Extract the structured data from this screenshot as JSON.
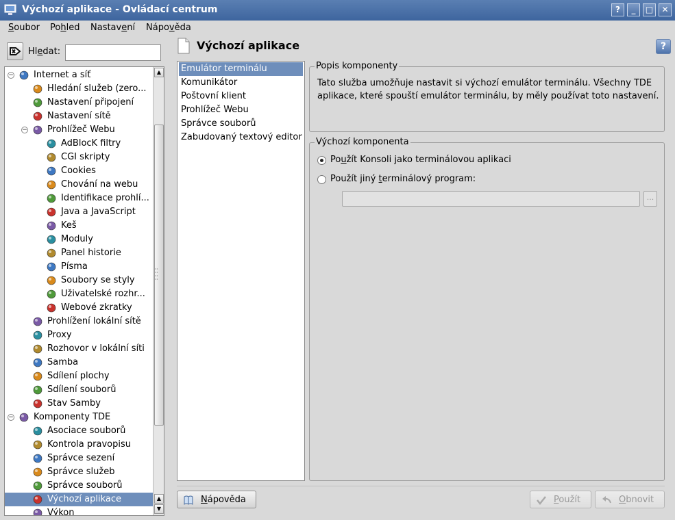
{
  "window": {
    "title": "Výchozí aplikace - Ovládací centrum",
    "buttons": {
      "help": "?",
      "minimize": "_",
      "maximize": "□",
      "close": "✕"
    }
  },
  "menubar": {
    "items": [
      {
        "pre": "",
        "u": "S",
        "post": "oubor"
      },
      {
        "pre": "Po",
        "u": "h",
        "post": "led"
      },
      {
        "pre": "Nastav",
        "u": "e",
        "post": "ní"
      },
      {
        "pre": "Nápo",
        "u": "v",
        "post": "ěda"
      }
    ]
  },
  "search": {
    "label_pre": "Hl",
    "label_u": "e",
    "label_post": "dat:",
    "value": "",
    "placeholder": ""
  },
  "tree": {
    "items": [
      {
        "label": "Internet a síť",
        "icon": "globe-icon",
        "level": 0,
        "expander": "⊖"
      },
      {
        "label": "Hledání služeb (zero...",
        "icon": "service-discovery-icon",
        "level": 1
      },
      {
        "label": "Nastavení připojení",
        "icon": "connection-icon",
        "level": 1
      },
      {
        "label": "Nastavení sítě",
        "icon": "network-icon",
        "level": 1
      },
      {
        "label": "Prohlížeč Webu",
        "icon": "web-browser-icon",
        "level": 1,
        "expander": "⊖"
      },
      {
        "label": "AdBlocK filtry",
        "icon": "filter-icon",
        "level": 2
      },
      {
        "label": "CGI skripty",
        "icon": "gear-icon",
        "level": 2
      },
      {
        "label": "Cookies",
        "icon": "cookie-icon",
        "level": 2
      },
      {
        "label": "Chování na webu",
        "icon": "globe-icon",
        "level": 2
      },
      {
        "label": "Identifikace prohlí...",
        "icon": "identification-icon",
        "level": 2
      },
      {
        "label": "Java a JavaScript",
        "icon": "java-icon",
        "level": 2
      },
      {
        "label": "Keš",
        "icon": "cache-icon",
        "level": 2
      },
      {
        "label": "Moduly",
        "icon": "plugin-icon",
        "level": 2
      },
      {
        "label": "Panel historie",
        "icon": "history-icon",
        "level": 2
      },
      {
        "label": "Písma",
        "icon": "font-icon",
        "level": 2
      },
      {
        "label": "Soubory se styly",
        "icon": "css-icon",
        "level": 2
      },
      {
        "label": "Uživatelské rozhr...",
        "icon": "ui-icon",
        "level": 2
      },
      {
        "label": "Webové zkratky",
        "icon": "shortcut-icon",
        "level": 2
      },
      {
        "label": "Prohlížení lokální sítě",
        "icon": "lan-browse-icon",
        "level": 1
      },
      {
        "label": "Proxy",
        "icon": "proxy-icon",
        "level": 1
      },
      {
        "label": "Rozhovor v lokální síti",
        "icon": "lan-chat-icon",
        "level": 1
      },
      {
        "label": "Samba",
        "icon": "samba-icon",
        "level": 1
      },
      {
        "label": "Sdílení plochy",
        "icon": "desktop-sharing-icon",
        "level": 1
      },
      {
        "label": "Sdílení souborů",
        "icon": "file-sharing-icon",
        "level": 1
      },
      {
        "label": "Stav Samby",
        "icon": "samba-status-icon",
        "level": 1
      },
      {
        "label": "Komponenty TDE",
        "icon": "components-icon",
        "level": 0,
        "expander": "⊖"
      },
      {
        "label": "Asociace souborů",
        "icon": "file-association-icon",
        "level": 1
      },
      {
        "label": "Kontrola pravopisu",
        "icon": "spellcheck-icon",
        "level": 1
      },
      {
        "label": "Správce sezení",
        "icon": "session-manager-icon",
        "level": 1
      },
      {
        "label": "Správce služeb",
        "icon": "service-manager-icon",
        "level": 1
      },
      {
        "label": "Správce souborů",
        "icon": "file-manager-icon",
        "level": 1
      },
      {
        "label": "Výchozí aplikace",
        "icon": "default-apps-icon",
        "level": 1,
        "selected": true
      },
      {
        "label": "Výkon",
        "icon": "performance-icon",
        "level": 1
      }
    ]
  },
  "header": {
    "title": "Výchozí aplikace",
    "help_glyph": "?"
  },
  "components": {
    "items": [
      {
        "label": "Emulátor terminálu",
        "selected": true
      },
      {
        "label": "Komunikátor"
      },
      {
        "label": "Poštovní klient"
      },
      {
        "label": "Prohlížeč Webu"
      },
      {
        "label": "Správce souborů"
      },
      {
        "label": "Zabudovaný textový editor"
      }
    ]
  },
  "description": {
    "legend": "Popis komponenty",
    "text": "Tato služba umožňuje nastavit si výchozí emulátor terminálu. Všechny TDE aplikace, které spouští emulátor terminálu, by měly používat toto nastavení."
  },
  "default_component": {
    "legend": "Výchozí komponenta",
    "option1": {
      "pre": "Po",
      "u": "u",
      "post": "žít Konsoli jako terminálovou aplikaci",
      "checked": true
    },
    "option2": {
      "pre": "Použít jiný ",
      "u": "t",
      "post": "erminálový program:",
      "checked": false
    },
    "program_value": "",
    "browse_label": "..."
  },
  "footer": {
    "help": {
      "u": "N",
      "post": "ápověda"
    },
    "apply": {
      "pre": "",
      "u": "P",
      "post": "oužít"
    },
    "reset": {
      "pre": "",
      "u": "O",
      "post": "bnovit"
    }
  }
}
